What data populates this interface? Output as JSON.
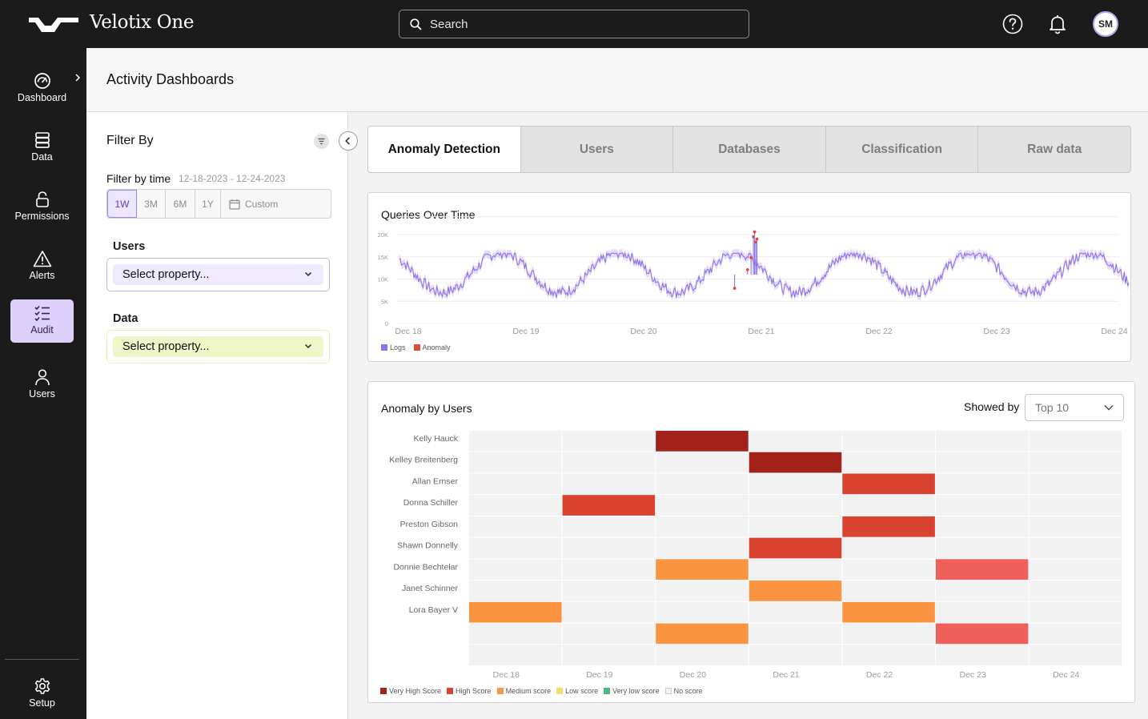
{
  "app": {
    "brand": "Velotix One",
    "avatar_initials": "SM"
  },
  "search": {
    "placeholder": "Search"
  },
  "sidebar": {
    "items": [
      {
        "label": "Dashboard",
        "icon": "dashboard-gauge-icon"
      },
      {
        "label": "Data",
        "icon": "database-icon"
      },
      {
        "label": "Permissions",
        "icon": "lock-icon"
      },
      {
        "label": "Alerts",
        "icon": "warning-icon"
      },
      {
        "label": "Audit",
        "icon": "checklist-icon",
        "active": true
      },
      {
        "label": "Users",
        "icon": "user-icon"
      }
    ],
    "setup": {
      "label": "Setup",
      "icon": "gear-icon"
    }
  },
  "page": {
    "title": "Activity Dashboards"
  },
  "filter": {
    "title": "Filter By",
    "time_label": "Filter by time",
    "time_range": "12-18-2023 - 12-24-2023",
    "periods": [
      "1W",
      "3M",
      "6M",
      "1Y"
    ],
    "active_period": "1W",
    "custom_label": "Custom",
    "users_label": "Users",
    "users_select": "Select property...",
    "data_label": "Data",
    "data_select": "Select property..."
  },
  "tabs": [
    {
      "label": "Anomaly Detection",
      "active": true
    },
    {
      "label": "Users"
    },
    {
      "label": "Databases"
    },
    {
      "label": "Classification"
    },
    {
      "label": "Raw data"
    }
  ],
  "queries_card": {
    "title": "Queries Over Time"
  },
  "anomaly_card": {
    "title": "Anomaly by Users",
    "showed_by_label": "Showed by",
    "showed_by_value": "Top 10"
  },
  "colors": {
    "logs": "#8f73e6",
    "logs_band": "#e2d8fb",
    "anomaly": "#e04a3c",
    "very_high": "#a3231a",
    "high": "#da4230",
    "medium": "#fa9440",
    "low": "#f2e064",
    "very_low": "#4cba7e",
    "none": "#f2f2f2",
    "accent": "#ddd1fb"
  },
  "chart_data": [
    {
      "type": "line",
      "title": "Queries Over Time",
      "y_ticks": [
        "0",
        "5K",
        "10K",
        "15K",
        "20K"
      ],
      "ylim": [
        0,
        20000
      ],
      "x_ticks": [
        "Dec 18",
        "Dec 19",
        "Dec 20",
        "Dec 21",
        "Dec 22",
        "Dec 23",
        "Dec 24"
      ],
      "grid": true,
      "legend_position": "bottom-left",
      "series": [
        {
          "name": "Logs",
          "period": "daily",
          "baseline": 11500,
          "amplitude": 4500,
          "peak_phase": 0.82,
          "note_range": [
            1500,
            20500
          ]
        }
      ],
      "anomaly_series": {
        "name": "Anomaly",
        "points": [
          {
            "x": 2.8,
            "y": 7900
          },
          {
            "x": 2.91,
            "y": 12100
          },
          {
            "x": 2.94,
            "y": 14800
          },
          {
            "x": 2.96,
            "y": 19500
          },
          {
            "x": 2.97,
            "y": 20600
          },
          {
            "x": 2.98,
            "y": 18300
          },
          {
            "x": 2.99,
            "y": 19000
          }
        ]
      }
    },
    {
      "type": "heatmap",
      "title": "Anomaly by Users",
      "x_categories": [
        "Dec 18",
        "Dec 19",
        "Dec 20",
        "Dec 21",
        "Dec 22",
        "Dec 23",
        "Dec 24"
      ],
      "y_categories": [
        "Kelly Hauck",
        "Kelley Breitenberg",
        "Allan Ernser",
        "Donna Schiller",
        "Preston Gibson",
        "Shawn Donnelly",
        "Donnie Bechtelar",
        "Janet Schinner",
        "Lora Bayer V",
        "",
        ""
      ],
      "levels": [
        "none",
        "very_high",
        "high",
        "medium",
        "low",
        "very_low"
      ],
      "cells": [
        {
          "row": 0,
          "col": 2,
          "level": "very_high"
        },
        {
          "row": 1,
          "col": 3,
          "level": "very_high"
        },
        {
          "row": 2,
          "col": 4,
          "level": "high"
        },
        {
          "row": 3,
          "col": 1,
          "level": "high"
        },
        {
          "row": 4,
          "col": 4,
          "level": "high"
        },
        {
          "row": 5,
          "col": 3,
          "level": "high"
        },
        {
          "row": 6,
          "col": 2,
          "level": "medium"
        },
        {
          "row": 6,
          "col": 5,
          "level": "light_high"
        },
        {
          "row": 7,
          "col": 3,
          "level": "medium"
        },
        {
          "row": 8,
          "col": 0,
          "level": "medium"
        },
        {
          "row": 8,
          "col": 4,
          "level": "medium"
        },
        {
          "row": 9,
          "col": 2,
          "level": "medium"
        },
        {
          "row": 9,
          "col": 5,
          "level": "light_high"
        }
      ],
      "legend": [
        {
          "label": "Very High Score",
          "color": "#a3231a"
        },
        {
          "label": "High Score",
          "color": "#da4230"
        },
        {
          "label": "Medium score",
          "color": "#fa9440"
        },
        {
          "label": "Low score",
          "color": "#f2e064"
        },
        {
          "label": "Very low score",
          "color": "#4cba7e"
        },
        {
          "label": "No score",
          "color": "#f2f2f2"
        }
      ],
      "legend_position": "bottom-left"
    }
  ]
}
